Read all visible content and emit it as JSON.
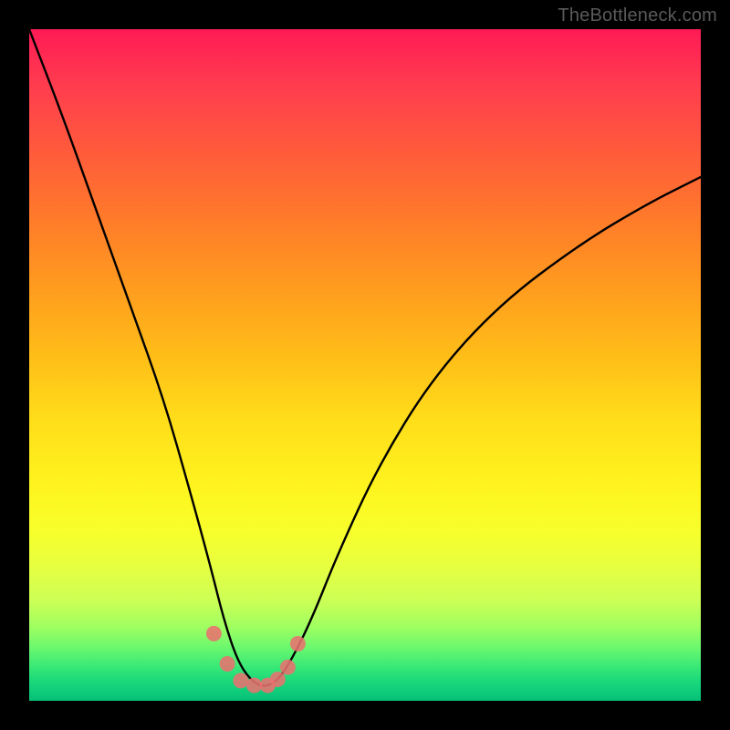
{
  "watermark": "TheBottleneck.com",
  "chart_data": {
    "type": "line",
    "title": "",
    "xlabel": "",
    "ylabel": "",
    "xlim": [
      0,
      100
    ],
    "ylim": [
      0,
      100
    ],
    "grid": false,
    "series": [
      {
        "name": "curve",
        "x": [
          0,
          5,
          10,
          15,
          20,
          24,
          27,
          29,
          31,
          33,
          35,
          37,
          39,
          42,
          46,
          52,
          60,
          70,
          82,
          92,
          100
        ],
        "values": [
          100,
          87,
          73,
          59,
          45,
          31,
          20,
          12,
          6,
          3,
          2,
          3,
          6,
          12,
          22,
          35,
          48,
          59,
          68,
          74,
          78
        ]
      }
    ],
    "markers": {
      "name": "points",
      "x": [
        27.5,
        29.5,
        31.5,
        33.5,
        35.5,
        37.0,
        38.5,
        40.0
      ],
      "values": [
        10.0,
        5.5,
        3.0,
        2.3,
        2.3,
        3.2,
        5.0,
        8.5
      ]
    },
    "background_gradient": {
      "stops": [
        {
          "pos": 0.0,
          "color": "#ff1a55"
        },
        {
          "pos": 0.35,
          "color": "#ff8a20"
        },
        {
          "pos": 0.66,
          "color": "#fff41e"
        },
        {
          "pos": 0.92,
          "color": "#6cf86e"
        },
        {
          "pos": 1.0,
          "color": "#07bf76"
        }
      ]
    }
  }
}
